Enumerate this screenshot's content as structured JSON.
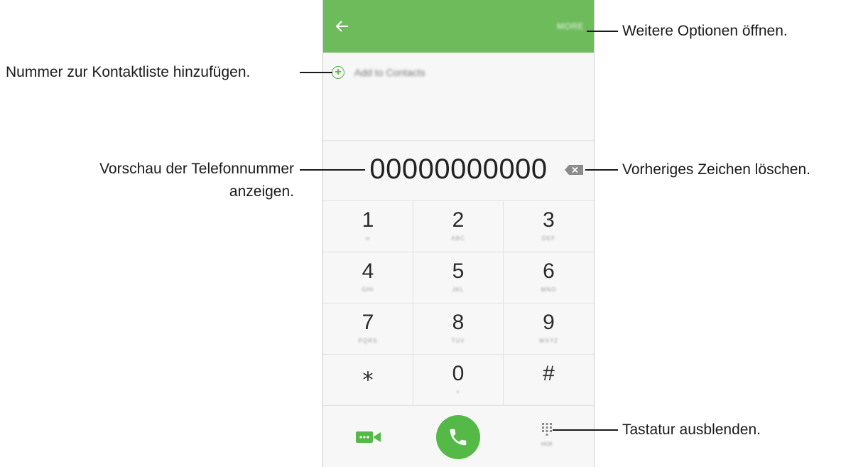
{
  "dialer": {
    "back_icon": "arrow-left-icon",
    "more_label": "MORE",
    "add_to_contacts_label": "Add to Contacts",
    "number": "00000000000",
    "keys": [
      {
        "digit": "1",
        "letters": "∞"
      },
      {
        "digit": "2",
        "letters": "ABC"
      },
      {
        "digit": "3",
        "letters": "DEF"
      },
      {
        "digit": "4",
        "letters": "GHI"
      },
      {
        "digit": "5",
        "letters": "JKL"
      },
      {
        "digit": "6",
        "letters": "MNO"
      },
      {
        "digit": "7",
        "letters": "PQRS"
      },
      {
        "digit": "8",
        "letters": "TUV"
      },
      {
        "digit": "9",
        "letters": "WXYZ"
      },
      {
        "digit": "⁎",
        "letters": ""
      },
      {
        "digit": "0",
        "letters": "+"
      },
      {
        "digit": "#",
        "letters": ""
      }
    ],
    "keypad_hide_label": "HIDE"
  },
  "callouts": {
    "more_options": "Weitere Optionen öffnen.",
    "add_contact": "Nummer zur Kontaktliste hinzufügen.",
    "preview_line1": "Vorschau der Telefonnummer",
    "preview_line2": "anzeigen.",
    "delete_char": "Vorheriges Zeichen löschen.",
    "hide_keypad": "Tastatur ausblenden."
  },
  "colors": {
    "accent": "#6dbb5b",
    "call_button": "#54b946"
  }
}
